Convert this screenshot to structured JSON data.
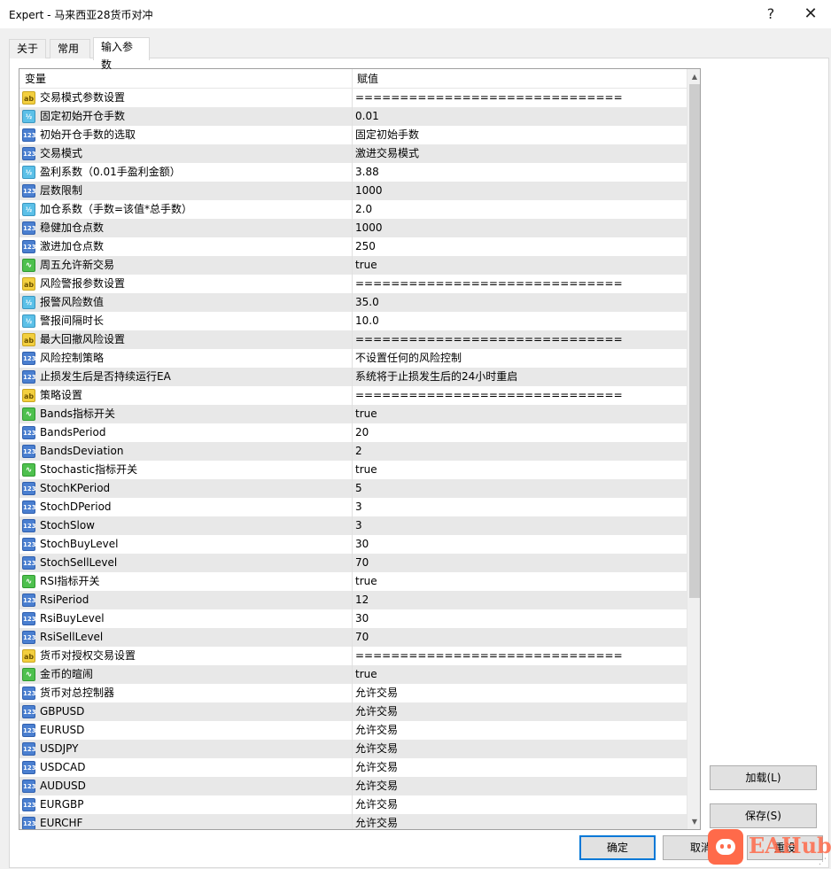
{
  "window": {
    "title": "Expert - 马来西亚28货币对冲",
    "help_glyph": "?",
    "close_glyph": "✕"
  },
  "tabs": [
    {
      "label": "关于"
    },
    {
      "label": "常用"
    },
    {
      "label": "输入参数"
    }
  ],
  "grid": {
    "header_variable": "变量",
    "header_value": "赋值",
    "rows": [
      {
        "icon": "ab",
        "name": "交易模式参数设置",
        "value": "=============================="
      },
      {
        "icon": "dbl",
        "name": "固定初始开仓手数",
        "value": "0.01"
      },
      {
        "icon": "int",
        "name": "初始开仓手数的选取",
        "value": "固定初始手数"
      },
      {
        "icon": "int",
        "name": "交易模式",
        "value": "激进交易模式"
      },
      {
        "icon": "dbl",
        "name": "盈利系数（0.01手盈利金额）",
        "value": "3.88"
      },
      {
        "icon": "int",
        "name": "层数限制",
        "value": "1000"
      },
      {
        "icon": "dbl",
        "name": "加仓系数（手数=该值*总手数）",
        "value": "2.0"
      },
      {
        "icon": "int",
        "name": "稳健加仓点数",
        "value": "1000"
      },
      {
        "icon": "int",
        "name": "激进加仓点数",
        "value": "250"
      },
      {
        "icon": "bool",
        "name": "周五允许新交易",
        "value": "true"
      },
      {
        "icon": "ab",
        "name": "风险警报参数设置",
        "value": "=============================="
      },
      {
        "icon": "dbl",
        "name": "报警风险数值",
        "value": "35.0"
      },
      {
        "icon": "dbl",
        "name": "警报间隔时长",
        "value": "10.0"
      },
      {
        "icon": "ab",
        "name": "最大回撤风险设置",
        "value": "=============================="
      },
      {
        "icon": "int",
        "name": "风险控制策略",
        "value": "不设置任何的风险控制"
      },
      {
        "icon": "int",
        "name": "止损发生后是否持续运行EA",
        "value": "系统将于止损发生后的24小时重启"
      },
      {
        "icon": "ab",
        "name": "策略设置",
        "value": "=============================="
      },
      {
        "icon": "bool",
        "name": "Bands指标开关",
        "value": "true"
      },
      {
        "icon": "int",
        "name": "BandsPeriod",
        "value": "20"
      },
      {
        "icon": "int",
        "name": "BandsDeviation",
        "value": "2"
      },
      {
        "icon": "bool",
        "name": "Stochastic指标开关",
        "value": "true"
      },
      {
        "icon": "int",
        "name": "StochKPeriod",
        "value": "5"
      },
      {
        "icon": "int",
        "name": "StochDPeriod",
        "value": "3"
      },
      {
        "icon": "int",
        "name": "StochSlow",
        "value": "3"
      },
      {
        "icon": "int",
        "name": "StochBuyLevel",
        "value": "30"
      },
      {
        "icon": "int",
        "name": "StochSellLevel",
        "value": "70"
      },
      {
        "icon": "bool",
        "name": "RSI指标开关",
        "value": "true"
      },
      {
        "icon": "int",
        "name": "RsiPeriod",
        "value": "12"
      },
      {
        "icon": "int",
        "name": "RsiBuyLevel",
        "value": "30"
      },
      {
        "icon": "int",
        "name": "RsiSellLevel",
        "value": "70"
      },
      {
        "icon": "ab",
        "name": "货币对授权交易设置",
        "value": "=============================="
      },
      {
        "icon": "bool",
        "name": "金币的暄闹",
        "value": "true"
      },
      {
        "icon": "int",
        "name": "货币对总控制器",
        "value": "允许交易"
      },
      {
        "icon": "int",
        "name": "GBPUSD",
        "value": "允许交易"
      },
      {
        "icon": "int",
        "name": "EURUSD",
        "value": "允许交易"
      },
      {
        "icon": "int",
        "name": "USDJPY",
        "value": "允许交易"
      },
      {
        "icon": "int",
        "name": "USDCAD",
        "value": "允许交易"
      },
      {
        "icon": "int",
        "name": "AUDUSD",
        "value": "允许交易"
      },
      {
        "icon": "int",
        "name": "EURGBP",
        "value": "允许交易"
      },
      {
        "icon": "int",
        "name": "EURCHF",
        "value": "允许交易"
      }
    ]
  },
  "icon_glyphs": {
    "ab": "ab",
    "dbl": "½",
    "int": "123",
    "bool": "∿"
  },
  "icon_names": {
    "ab": "string-type-icon",
    "dbl": "double-type-icon",
    "int": "integer-type-icon",
    "bool": "bool-type-icon"
  },
  "buttons": {
    "load": "加载(L)",
    "save": "保存(S)",
    "ok": "确定",
    "cancel": "取消",
    "reset": "重设"
  },
  "watermark": {
    "text": "EAHub"
  },
  "colors": {
    "focus_border": "#0078d7",
    "logo": "#ff6a4a",
    "row_alt": "#e8e8e8"
  }
}
